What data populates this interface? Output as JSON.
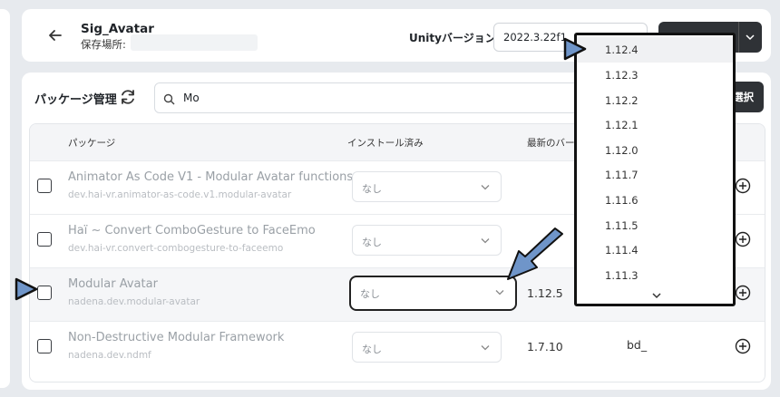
{
  "header": {
    "project_name": "Sig_Avatar",
    "location_label": "保存場所:",
    "unity_label": "Unityバージョン:",
    "unity_version": "2022.3.22f1"
  },
  "packages": {
    "title": "パッケージ管理",
    "search_value": "Mo",
    "select_button_label": "選択",
    "columns": [
      "パッケージ",
      "インストール済み",
      "最新のバージ"
    ],
    "rows": [
      {
        "name": "Animator As Code V1 - Modular Avatar functions",
        "id": "dev.hai-vr.animator-as-code.v1.modular-avatar",
        "installed": "なし",
        "latest": "",
        "author": ""
      },
      {
        "name": "Haï ~ Convert ComboGesture to FaceEmo",
        "id": "dev.hai-vr.convert-combogesture-to-faceemo",
        "installed": "なし",
        "latest": "",
        "author": ""
      },
      {
        "name": "Modular Avatar",
        "id": "nadena.dev.modular-avatar",
        "installed": "なし",
        "latest": "1.12.5",
        "author": ""
      },
      {
        "name": "Non-Destructive Modular Framework",
        "id": "nadena.dev.ndmf",
        "installed": "なし",
        "latest": "1.7.10",
        "author": "bd_"
      }
    ]
  },
  "version_dropdown": {
    "items": [
      "1.12.4",
      "1.12.3",
      "1.12.2",
      "1.12.1",
      "1.12.0",
      "1.11.7",
      "1.11.6",
      "1.11.5",
      "1.11.4",
      "1.11.3"
    ],
    "selected": "1.12.4"
  },
  "colors": {
    "accent_dark": "#2f3236",
    "annotation_arrow": "#6f95c9",
    "background": "#e7eaee"
  }
}
